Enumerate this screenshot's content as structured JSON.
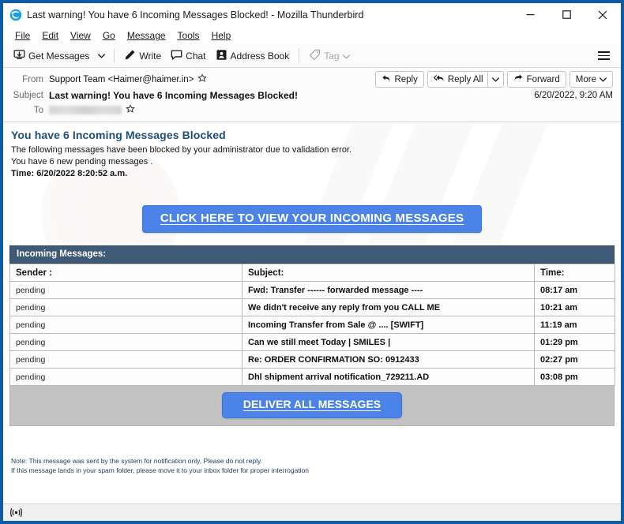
{
  "window": {
    "title": "Last warning! You have 6 Incoming Messages Blocked! - Mozilla Thunderbird",
    "app_icon": "thunderbird-icon",
    "minimize_label": "Minimize",
    "maximize_label": "Maximize",
    "close_label": "Close",
    "border_color": "#0e5ba6"
  },
  "menubar": {
    "items": [
      {
        "label": "File",
        "accel": "F"
      },
      {
        "label": "Edit",
        "accel": "E"
      },
      {
        "label": "View",
        "accel": "V"
      },
      {
        "label": "Go",
        "accel": "G"
      },
      {
        "label": "Message",
        "accel": "M"
      },
      {
        "label": "Tools",
        "accel": "T"
      },
      {
        "label": "Help",
        "accel": "H"
      }
    ]
  },
  "toolbar": {
    "get_messages": "Get Messages",
    "write": "Write",
    "chat": "Chat",
    "address_book": "Address Book",
    "tag": "Tag",
    "app_menu": "Application Menu"
  },
  "message_header": {
    "from_label": "From",
    "from_value": "Support Team <Haimer@haimer.in>",
    "subject_label": "Subject",
    "subject_value": "Last warning! You have 6 Incoming Messages Blocked!",
    "to_label": "To",
    "to_value": "",
    "date": "6/20/2022, 9:20 AM",
    "actions": {
      "reply": "Reply",
      "reply_all": "Reply All",
      "forward": "Forward",
      "more": "More"
    }
  },
  "email": {
    "heading": "You have 6 Incoming Messages Blocked",
    "line1": "The following messages have been blocked by your administrator due to validation error.",
    "line2": "You have 6 new pending messages .",
    "line3": "Time: 6/20/2022 8:20:52 a.m.",
    "cta_label": "CLICK HERE TO VIEW YOUR INCOMING MESSAGES",
    "cta_color": "#4c83e8",
    "table_title": "Incoming  Messages:",
    "table_title_color": "#3f5a77",
    "columns": [
      "Sender :",
      "Subject:",
      "Time:"
    ],
    "rows": [
      {
        "sender": "pending",
        "subject": "Fwd: Transfer   ------  forwarded message ----",
        "time": "08:17 am"
      },
      {
        "sender": "pending",
        "subject": "We didn't receive any reply from you CALL ME",
        "time": "10:21 am"
      },
      {
        "sender": "pending",
        "subject": "Incoming Transfer from Sale @ .... [SWIFT]",
        "time": "11:19 am"
      },
      {
        "sender": "pending",
        "subject": "Can we still meet Today  | SMILES |",
        "time": "01:29 pm"
      },
      {
        "sender": "pending",
        "subject": "Re: ORDER CONFIRMATION SO: 0912433",
        "time": "02:27 pm"
      },
      {
        "sender": "pending",
        "subject": "Dhl shipment arrival notification_729211.AD",
        "time": "03:08 pm"
      }
    ],
    "deliver_label": "DELIVER ALL MESSAGES",
    "note1": "Note: This message was sent by the system for notification only, Please do not reply.",
    "note2": "If this message lands in your spam folder, please move it to your inbox folder for proper interrogation"
  },
  "statusbar": {
    "icon": "broadcast-icon",
    "text": ""
  }
}
